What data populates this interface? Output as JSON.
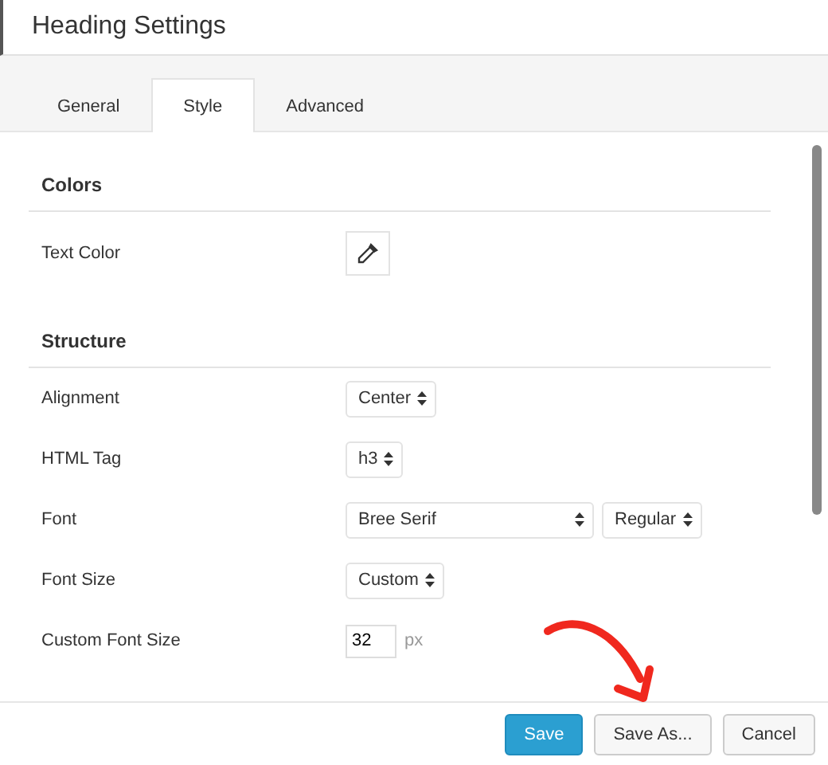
{
  "window": {
    "title": "Heading Settings"
  },
  "tabs": [
    {
      "label": "General",
      "selected": false
    },
    {
      "label": "Style",
      "selected": true
    },
    {
      "label": "Advanced",
      "selected": false
    }
  ],
  "sections": [
    {
      "title": "Colors",
      "rows": [
        {
          "kind": "color",
          "label": "Text Color"
        }
      ]
    },
    {
      "title": "Structure",
      "rows": [
        {
          "kind": "select",
          "label": "Alignment",
          "value": "Center"
        },
        {
          "kind": "select",
          "label": "HTML Tag",
          "value": "h3"
        },
        {
          "kind": "select2",
          "label": "Font",
          "value": "Bree Serif",
          "value2": "Regular"
        },
        {
          "kind": "select",
          "label": "Font Size",
          "value": "Custom"
        },
        {
          "kind": "number",
          "label": "Custom Font Size",
          "value": "32",
          "unit": "px"
        }
      ]
    }
  ],
  "buttons": [
    {
      "label": "Save",
      "kind": "primary"
    },
    {
      "label": "Save As...",
      "kind": "default"
    },
    {
      "label": "Cancel",
      "kind": "default"
    }
  ]
}
